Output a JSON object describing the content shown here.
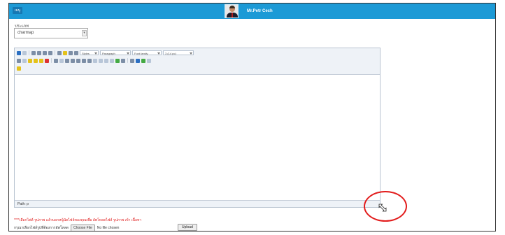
{
  "topbar": {
    "menu_label": "เมนู",
    "username": "Mr.Petr Cech"
  },
  "form": {
    "field_label": "ประเภท",
    "select_value": "charmap"
  },
  "editor": {
    "style_dropdown": "Styles",
    "format_dropdown": "Paragraph",
    "font_family_dropdown": "Font family",
    "font_size_dropdown": "3 (14 pc)",
    "path_label": "Path: p"
  },
  "upload": {
    "warning": "****เลือกไฟล์ รูปภาพ แล้วบอกหนู้นัดไฟล์ของคุณเพื่อ อัพโหลดไฟล์ รูปภาพ เข้า เนื้อหา",
    "label": "กรุณาเลือกไฟล์รูปที่ต้องการอัพโหลด",
    "choose_button": "Choose File",
    "no_file_text": "No file chosen",
    "upload_button": "Upload"
  },
  "colors": {
    "topbar": "#1c9ad6",
    "highlight_circle": "#e21b1b",
    "warning_text": "#e01b1b"
  },
  "icons": [
    "user-avatar-icon",
    "resize-cursor-icon",
    "chevron-down-icon"
  ]
}
